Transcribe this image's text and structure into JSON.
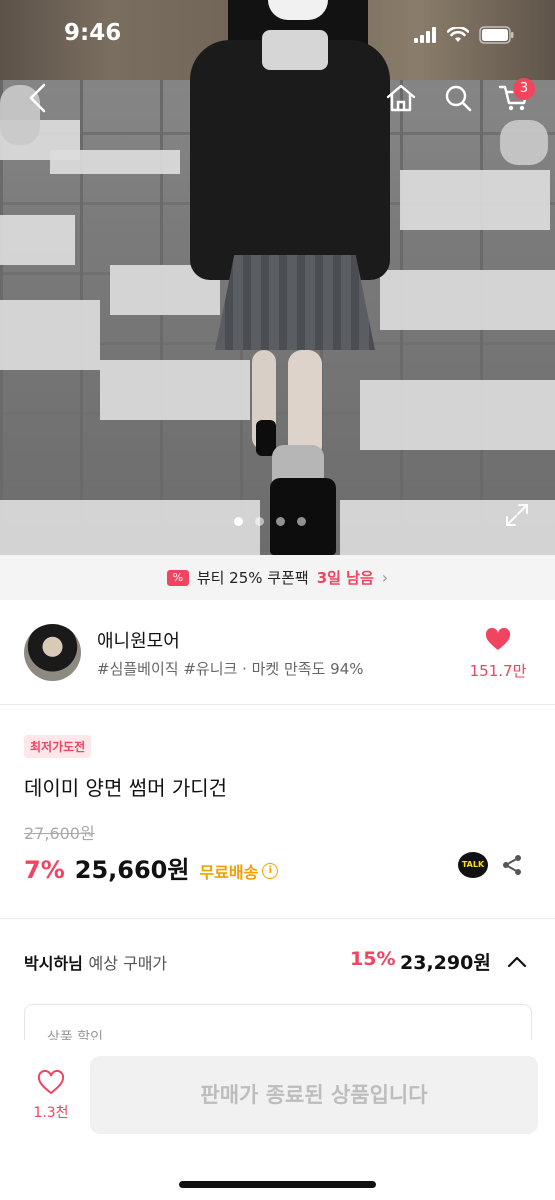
{
  "status_bar": {
    "time": "9:46"
  },
  "top_nav": {
    "cart_count": "3"
  },
  "gallery": {
    "page_count": 4,
    "active_index": 0
  },
  "coupon": {
    "text": "뷰티 25% 쿠폰팩",
    "days": "3일 남음"
  },
  "seller": {
    "name": "애니원모어",
    "tags": "#심플베이직 #유니크 · 마켓 만족도 94%",
    "likes": "151.7만"
  },
  "product": {
    "badge": "최저가도전",
    "title": "데이미 양면 썸머 가디건",
    "original_price": "27,600원",
    "discount": "7%",
    "price": "25,660원",
    "shipping": "무료배송",
    "talk_label": "TALK"
  },
  "expected_price": {
    "user": "박시하님",
    "label": "예상 구매가",
    "discount": "15%",
    "price": "23,290원"
  },
  "detail_box": {
    "label": "상품 할인"
  },
  "bottom_bar": {
    "like_count": "1.3천",
    "buy_label": "판매가 종료된 상품입니다"
  },
  "colors": {
    "accent": "#f04460",
    "shipping": "#f2a100"
  }
}
